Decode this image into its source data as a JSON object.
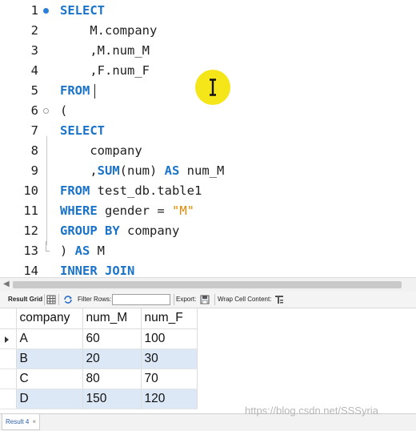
{
  "editor": {
    "lines": [
      {
        "n": "1",
        "parts": [
          {
            "t": "SELECT",
            "k": true
          }
        ]
      },
      {
        "n": "2",
        "parts": [
          {
            "t": "    M.company"
          }
        ]
      },
      {
        "n": "3",
        "parts": [
          {
            "t": "    ,M.num_M"
          }
        ]
      },
      {
        "n": "4",
        "parts": [
          {
            "t": "    ,F.num_F"
          }
        ]
      },
      {
        "n": "5",
        "parts": [
          {
            "t": "FROM",
            "k": true
          }
        ]
      },
      {
        "n": "6",
        "parts": [
          {
            "t": "("
          }
        ]
      },
      {
        "n": "7",
        "parts": [
          {
            "t": "SELECT",
            "k": true
          }
        ]
      },
      {
        "n": "8",
        "parts": [
          {
            "t": "    company"
          }
        ]
      },
      {
        "n": "9",
        "parts": [
          {
            "t": "    ,"
          },
          {
            "t": "SUM",
            "k": true
          },
          {
            "t": "(num) "
          },
          {
            "t": "AS",
            "k": true
          },
          {
            "t": " num_M"
          }
        ]
      },
      {
        "n": "10",
        "parts": [
          {
            "t": "FROM",
            "k": true
          },
          {
            "t": " test_db.table1"
          }
        ]
      },
      {
        "n": "11",
        "parts": [
          {
            "t": "WHERE",
            "k": true
          },
          {
            "t": " gender = "
          },
          {
            "t": "\"M\"",
            "s": true
          }
        ]
      },
      {
        "n": "12",
        "parts": [
          {
            "t": "GROUP BY",
            "k": true
          },
          {
            "t": " company"
          }
        ]
      },
      {
        "n": "13",
        "parts": [
          {
            "t": ") "
          },
          {
            "t": "AS",
            "k": true
          },
          {
            "t": " M"
          }
        ]
      },
      {
        "n": "14",
        "parts": [
          {
            "t": "INNER JOIN",
            "k": true
          }
        ]
      }
    ],
    "cursor_line": "5"
  },
  "toolbar": {
    "result_grid": "Result Grid",
    "filter_rows": "Filter Rows:",
    "filter_value": "",
    "export": "Export:",
    "wrap": "Wrap Cell Content:"
  },
  "grid": {
    "columns": [
      "company",
      "num_M",
      "num_F"
    ],
    "rows": [
      [
        "A",
        "60",
        "100"
      ],
      [
        "B",
        "20",
        "30"
      ],
      [
        "C",
        "80",
        "70"
      ],
      [
        "D",
        "150",
        "120"
      ]
    ]
  },
  "bottom": {
    "tab": "Result 4",
    "close": "×"
  },
  "watermark": "https://blog.csdn.net/SSSyria",
  "colors": {
    "keyword": "#1a73c9",
    "string": "#e68a00",
    "row_alt": "#dde8f7",
    "cursor_highlight": "#f5e61a"
  }
}
